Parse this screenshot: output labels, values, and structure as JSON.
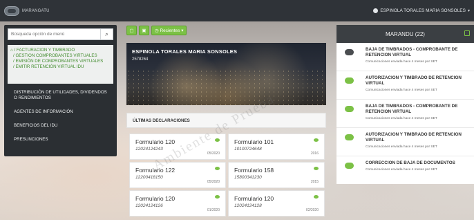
{
  "app": {
    "brand": "MARANGATU",
    "user": "ESPINOLA TORALES MARIA SONSOLES"
  },
  "search": {
    "placeholder": "Búsqueda opción de menú",
    "icon": "search-icon"
  },
  "breadcrumbs": [
    "/ FACTURACION Y TIMBRADO",
    "/ GESTION COMPROBANTES VIRTUALES",
    "/ EMISIÓN DE COMPROBANTES VIRTUALES",
    "/ EMITIR RETENCIÓN VIRTUAL IDU"
  ],
  "menu": [
    "DISTRIBUCIÓN DE UTILIDADES, DIVIDENDOS O RENDIMIENTOS",
    "AGENTES DE INFORMACIÓN",
    "BENEFICIOS DEL IDU",
    "PRESUNCIONES"
  ],
  "toolbar": {
    "recent_label": "Recientes"
  },
  "hero": {
    "name": "ESPINOLA TORALES MARIA SONSOLES",
    "ruc": "2578264"
  },
  "declarations": {
    "title": "ÚLTIMAS DECLARACIONES",
    "items": [
      {
        "form": "Formulario 120",
        "number": "12024124243",
        "period": "05/2020"
      },
      {
        "form": "Formulario 101",
        "number": "10100724648",
        "period": "2016"
      },
      {
        "form": "Formulario 122",
        "number": "12200418150",
        "period": "05/2020"
      },
      {
        "form": "Formulario 158",
        "number": "15800341230",
        "period": "2015"
      },
      {
        "form": "Formulario 120",
        "number": "12024124126",
        "period": "01/2020"
      },
      {
        "form": "Formulario 120",
        "number": "12024124128",
        "period": "02/2020"
      }
    ]
  },
  "marandu": {
    "title": "MARANDU (22)",
    "items": [
      {
        "title": "BAJA DE TIMBRADOS - COMPROBANTE DE RETENCION VIRTUAL",
        "sub": "Comunicaciones enviada hace 4 meses por SET",
        "tone": "dark"
      },
      {
        "title": "AUTORIZACION Y TIMBRADO DE RETENCION VIRTUAL",
        "sub": "Comunicaciones enviada hace 4 meses por SET",
        "tone": "green"
      },
      {
        "title": "BAJA DE TIMBRADOS - COMPROBANTE DE RETENCION VIRTUAL",
        "sub": "Comunicaciones enviada hace 4 meses por SET",
        "tone": "green"
      },
      {
        "title": "AUTORIZACION Y TIMBRADO DE RETENCION VIRTUAL",
        "sub": "Comunicaciones enviada hace 4 meses por SET",
        "tone": "green"
      },
      {
        "title": "CORRECCION DE BAJA DE DOCUMENTOS",
        "sub": "Comunicaciones enviada hace 4 meses por SET",
        "tone": "green"
      }
    ]
  },
  "watermark": "Ambiente de Prueba",
  "colors": {
    "accent": "#7cc146",
    "dark": "#2b2f33"
  }
}
